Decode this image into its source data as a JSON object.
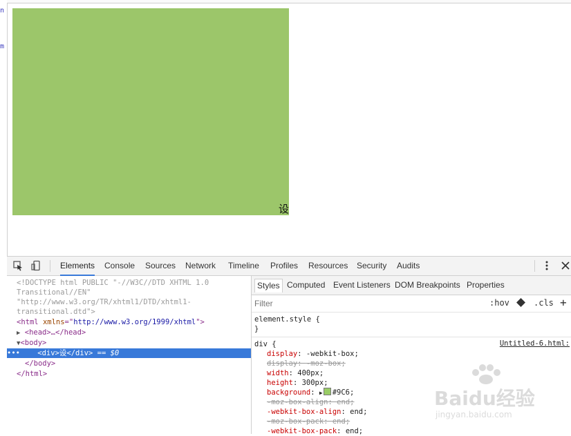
{
  "left_edge": {
    "chars": [
      "n",
      "m"
    ]
  },
  "page": {
    "box_text": "设",
    "box_color": "#9CC66A"
  },
  "devtools": {
    "tabs": [
      "Elements",
      "Console",
      "Sources",
      "Network",
      "Timeline",
      "Profiles",
      "Resources",
      "Security",
      "Audits"
    ],
    "active_tab": "Elements",
    "dom_lines": [
      "<!DOCTYPE html PUBLIC \"-//W3C//DTD XHTML 1.0",
      "Transitional//EN\"",
      "\"http://www.w3.org/TR/xhtml1/DTD/xhtml1-",
      "transitional.dtd\">"
    ],
    "html_open": {
      "tag": "<html ",
      "attr": "xmlns",
      "eq": "=\"",
      "val": "http://www.w3.org/1999/xhtml",
      "close": "\">"
    },
    "head_line": "<head>…</head>",
    "body_open": "<body>",
    "selected_line": {
      "prefix": "•••",
      "open": "<div>",
      "text": "设",
      "close": "</div>",
      "suffix": " == $0"
    },
    "body_close": "</body>",
    "html_close": "</html>",
    "styles_tabs": [
      "Styles",
      "Computed",
      "Event Listeners",
      "DOM Breakpoints",
      "Properties"
    ],
    "filter_placeholder": "Filter",
    "hov_label": ":hov",
    "cls_label": ".cls",
    "add_label": "+",
    "element_style": {
      "selector": "element.style {",
      "close": "}"
    },
    "div_rule": {
      "selector": "div {",
      "source": "Untitled-6.html:",
      "props": [
        {
          "name": "display",
          "value": "-webkit-box;",
          "struck": false
        },
        {
          "name": "display",
          "value": "-moz-box;",
          "struck": true
        },
        {
          "name": "width",
          "value": "400px;",
          "struck": false
        },
        {
          "name": "height",
          "value": "300px;",
          "struck": false
        },
        {
          "name": "background",
          "value": "#9C6;",
          "struck": false,
          "swatch": "#99CC66"
        },
        {
          "name": "-moz-box-align",
          "value": "end;",
          "struck": true
        },
        {
          "name": "-webkit-box-align",
          "value": "end;",
          "struck": false
        },
        {
          "name": "-moz-box-pack",
          "value": "end;",
          "struck": true
        },
        {
          "name": "-webkit-box-pack",
          "value": "end;",
          "struck": false
        }
      ]
    }
  },
  "watermark": {
    "text": "Baidu经验",
    "sub": "jingyan.baidu.com"
  }
}
